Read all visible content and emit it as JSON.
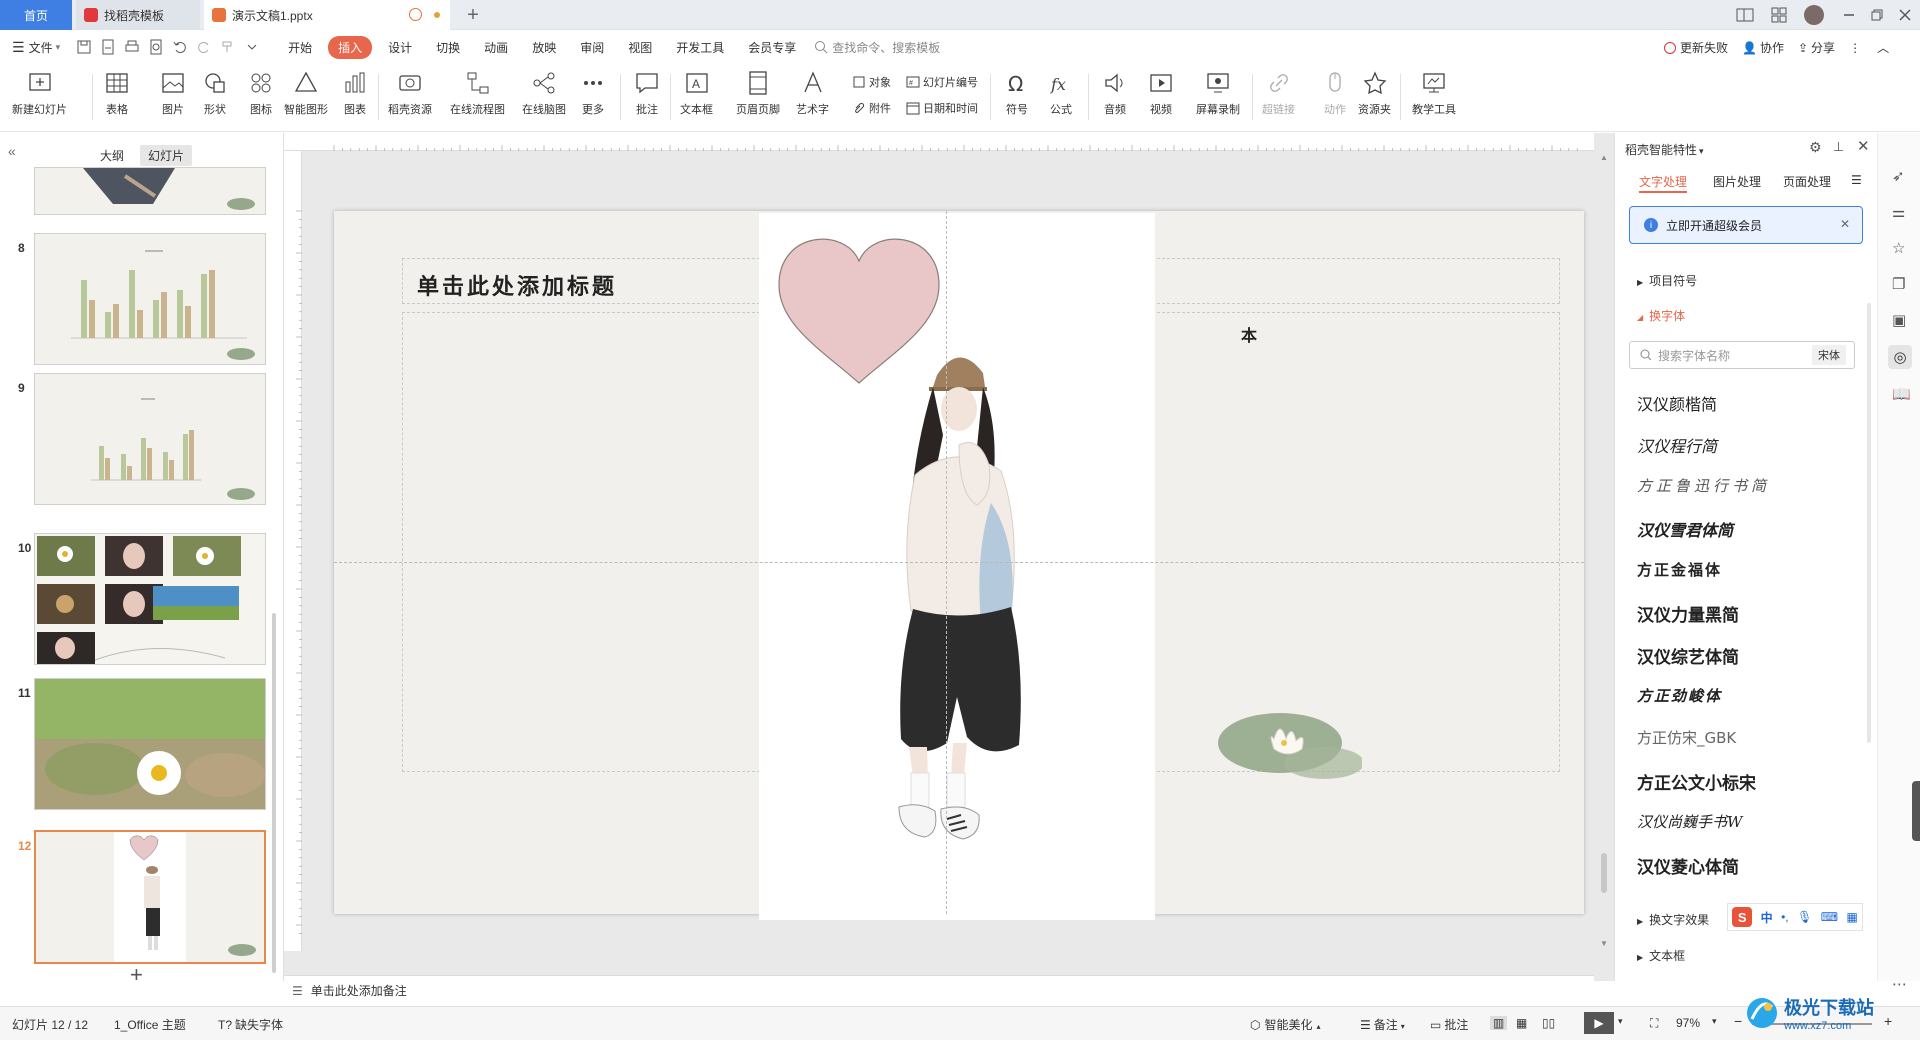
{
  "tabs": {
    "home": "首页",
    "template": "找稻壳模板",
    "doc": "演示文稿1.pptx"
  },
  "menu": {
    "file": "文件",
    "items": [
      "开始",
      "插入",
      "设计",
      "切换",
      "动画",
      "放映",
      "审阅",
      "视图",
      "开发工具",
      "会员专享"
    ],
    "active": "插入",
    "search_placeholder": "查找命令、搜索模板",
    "update": "更新失败",
    "collab": "协作",
    "share": "分享"
  },
  "ribbon": {
    "new_slide": "新建幻灯片",
    "table": "表格",
    "picture": "图片",
    "shape": "形状",
    "icon": "图标",
    "smart_shape": "智能图形",
    "chart": "图表",
    "docer_resource": "稻壳资源",
    "flowchart": "在线流程图",
    "mindmap": "在线脑图",
    "more": "更多",
    "comment": "批注",
    "textbox": "文本框",
    "header_footer": "页眉页脚",
    "wordart": "艺术字",
    "object": "对象",
    "slide_number": "幻灯片编号",
    "attachment": "附件",
    "datetime": "日期和时间",
    "symbol": "符号",
    "formula": "公式",
    "audio": "音频",
    "video": "视频",
    "screen_record": "屏幕录制",
    "hyperlink": "超链接",
    "action": "动作",
    "resource_folder": "资源夹",
    "teaching_tools": "教学工具"
  },
  "leftpanel": {
    "tab_outline": "大纲",
    "tab_slides": "幻灯片",
    "slides": [
      {
        "num": "8"
      },
      {
        "num": "9"
      },
      {
        "num": "10"
      },
      {
        "num": "11"
      },
      {
        "num": "12"
      }
    ]
  },
  "slide": {
    "title_placeholder": "单击此处添加标题",
    "content_placeholder": "本"
  },
  "notes": {
    "placeholder": "单击此处添加备注"
  },
  "rightpanel": {
    "title": "稻壳智能特性",
    "tabs": [
      "文字处理",
      "图片处理",
      "页面处理"
    ],
    "promo": "立即开通超级会员",
    "sec_bullets": "项目符号",
    "sec_font": "换字体",
    "search_placeholder": "搜索字体名称",
    "current_font": "宋体",
    "fonts": [
      "汉仪颜楷简",
      "汉仪程行简",
      "方正鲁迅行书简",
      "汉仪雪君体简",
      "方正金福体",
      "汉仪力量黑简",
      "汉仪综艺体简",
      "方正劲峻体",
      "方正仿宋_GBK",
      "方正公文小标宋",
      "汉仪尚巍手书W",
      "汉仪菱心体简"
    ],
    "sec_effects": "换文字效果",
    "sec_textbox": "文本框"
  },
  "status": {
    "slide_count": "幻灯片 12 / 12",
    "theme": "1_Office 主题",
    "missing_fonts": "缺失字体",
    "smart_beautify": "智能美化",
    "notes": "备注",
    "comments": "批注",
    "zoom": "97%"
  },
  "watermark": {
    "text": "极光下载站",
    "url": "www.xz7.com"
  },
  "colors": {
    "accent": "#3f7fe3",
    "insert_tab": "#e8664b",
    "selected_thumb": "#e8884b",
    "heart": "#e9c7c9"
  }
}
